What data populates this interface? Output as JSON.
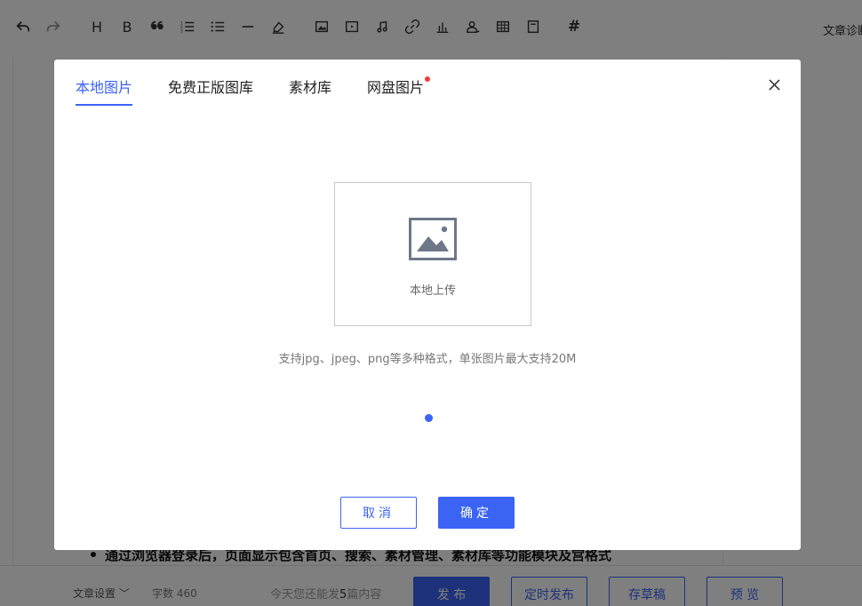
{
  "toolbar": {
    "items": [
      "undo-icon",
      "redo-icon",
      "heading-icon",
      "bold-icon",
      "quote-icon",
      "ordered-list-icon",
      "bullet-list-icon",
      "divider-icon",
      "eraser-icon",
      "image-icon",
      "video-icon",
      "music-icon",
      "link-icon",
      "chart-icon",
      "profile-icon",
      "table-icon",
      "card-icon",
      "hashtag-icon"
    ],
    "heading_label": "H",
    "bold_label": "B",
    "hashtag_label": "#",
    "diagnose_label": "文章诊断"
  },
  "document": {
    "bullet_text": "通过浏览器登录后，页面显示包含首页、搜索、素材管理、素材库等功能模块及宫格式"
  },
  "bottom_bar": {
    "settings_label": "文章设置 ﹀",
    "word_count_label": "字数 460",
    "hint_prefix": "今天您还能发",
    "hint_count": "5",
    "hint_suffix": "篇内容",
    "publish_label": "发 布",
    "schedule_label": "定时发布",
    "draft_label": "存草稿",
    "preview_label": "预 览"
  },
  "modal": {
    "tabs": [
      {
        "label": "本地图片",
        "active": true
      },
      {
        "label": "免费正版图库",
        "active": false
      },
      {
        "label": "素材库",
        "active": false
      },
      {
        "label": "网盘图片",
        "active": false,
        "badge": true
      }
    ],
    "upload_label": "本地上传",
    "upload_hint": "支持jpg、jpeg、png等多种格式，单张图片最大支持20M",
    "cancel_label": "取消",
    "confirm_label": "确定"
  },
  "colors": {
    "accent": "#3b64f5",
    "badge": "#f33b3b",
    "overlay": "rgba(0,0,0,0.5)"
  }
}
